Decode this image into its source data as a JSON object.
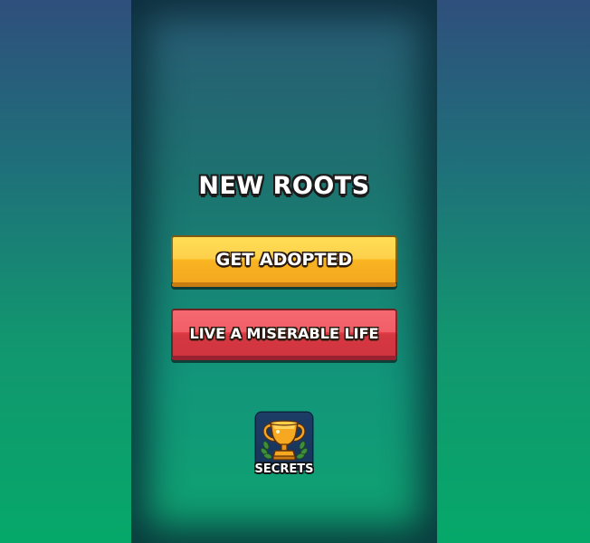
{
  "game": {
    "title": "NEW ROOTS"
  },
  "buttons": {
    "primary_label": "GET ADOPTED",
    "secondary_label": "LIVE A MISERABLE LIFE"
  },
  "secrets": {
    "label": "SECRETS",
    "icon": "trophy-icon"
  },
  "colors": {
    "primary_button": "#fdc82d",
    "secondary_button": "#ef444f",
    "secrets_tile": "#1d3c66"
  }
}
